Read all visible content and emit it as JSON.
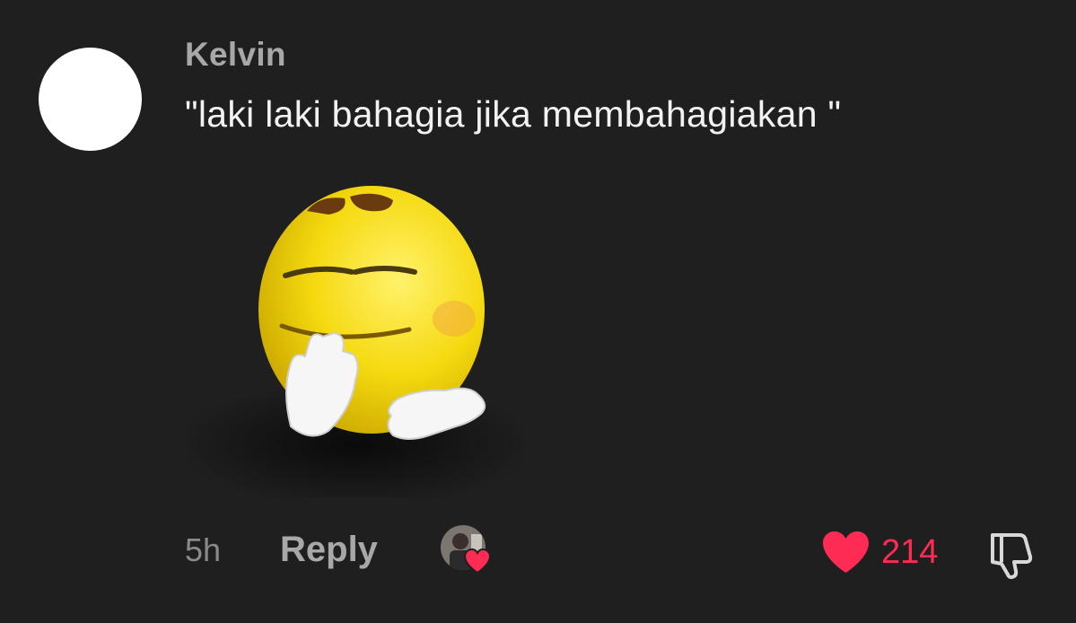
{
  "comment": {
    "username": "Kelvin",
    "text": "\"laki laki bahagia jika membahagiakan \"",
    "time": "5h",
    "reply_label": "Reply",
    "like_count": "214"
  },
  "colors": {
    "background": "#1f1f1f",
    "like_red": "#fe2c55",
    "muted_text": "#a8a8a8"
  },
  "icons": {
    "like": "heart-icon",
    "dislike": "thumbs-down-icon",
    "creator_liked": "creator-liked-heart-icon"
  }
}
